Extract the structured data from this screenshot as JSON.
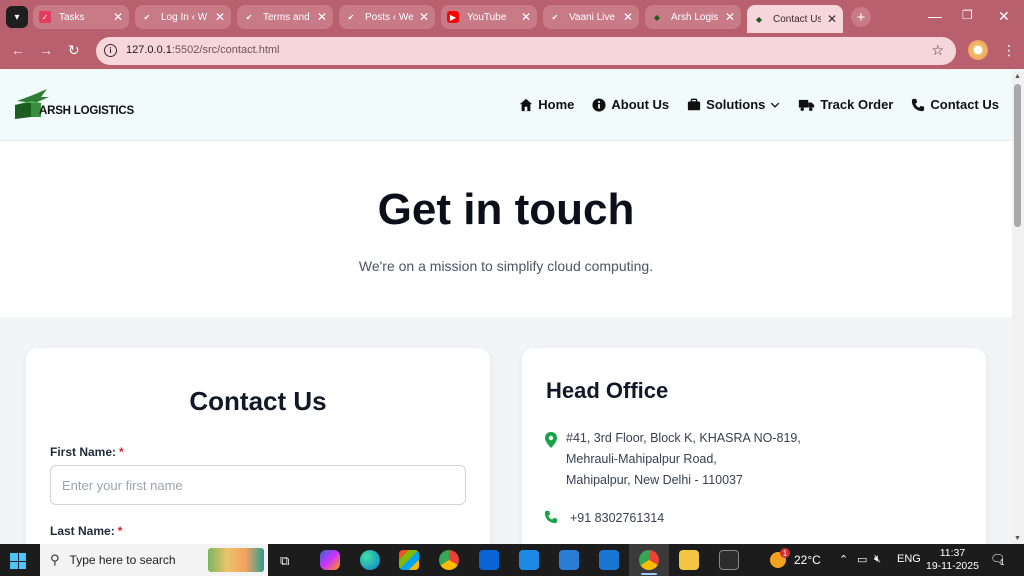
{
  "browser": {
    "tabs": [
      {
        "title": "Tasks",
        "favicon": "tasks-icon",
        "color": "#e03e5c"
      },
      {
        "title": "Log In ‹ W",
        "favicon": "checkmark-logo-icon",
        "color": "#c0392b"
      },
      {
        "title": "Terms and",
        "favicon": "checkmark-logo-icon",
        "color": "#c0392b"
      },
      {
        "title": "Posts ‹ We",
        "favicon": "checkmark-logo-icon",
        "color": "#c0392b"
      },
      {
        "title": "YouTube",
        "favicon": "youtube-icon",
        "color": "#ff0000"
      },
      {
        "title": "Vaani Live",
        "favicon": "checkmark-logo-icon",
        "color": "#c0392b"
      },
      {
        "title": "Arsh Logis",
        "favicon": "arsh-logo-icon",
        "color": "#2e7d32"
      },
      {
        "title": "Contact Us",
        "favicon": "arsh-logo-icon",
        "color": "#2e7d32"
      }
    ],
    "address": {
      "host": "127.0.0.1",
      "path": ":5502/src/contact.html"
    }
  },
  "site": {
    "logo_text": "ARSH LOGISTICS",
    "nav": [
      {
        "label": "Home",
        "icon": "home-icon"
      },
      {
        "label": "About Us",
        "icon": "info-icon"
      },
      {
        "label": "Solutions",
        "icon": "briefcase-icon"
      },
      {
        "label": "Track Order",
        "icon": "truck-icon"
      },
      {
        "label": "Contact Us",
        "icon": "phone-icon"
      }
    ]
  },
  "hero": {
    "title": "Get in touch",
    "subtitle": "We're on a mission to simplify cloud computing."
  },
  "contact_form": {
    "title": "Contact Us",
    "first_name_label": "First Name:",
    "first_name_placeholder": "Enter your first name",
    "last_name_label": "Last Name:",
    "required_mark": "*"
  },
  "office": {
    "title": "Head Office",
    "address_lines": [
      "#41, 3rd Floor, Block K, KHASRA NO-819,",
      "Mehrauli-Mahipalpur Road,",
      "Mahipalpur, New Delhi - 110037"
    ],
    "phone": "+91 8302761314"
  },
  "taskbar": {
    "search_placeholder": "Type here to search",
    "temperature": "22°C",
    "language": "ENG",
    "time": "11:37",
    "date": "19-11-2025",
    "weather_badge": "1",
    "notification_count": "1"
  },
  "colors": {
    "accent_green": "#16a34a",
    "required_red": "#dc2626",
    "chrome": "#b8606e"
  }
}
